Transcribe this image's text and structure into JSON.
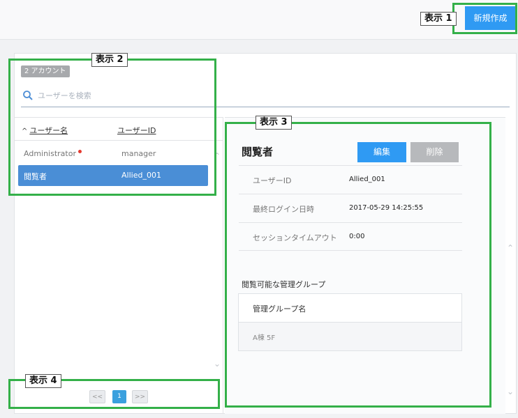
{
  "header": {
    "new_button": "新規作成"
  },
  "search": {
    "account_count": "2 アカウント",
    "placeholder": "ユーザーを検索"
  },
  "list": {
    "sort_arrow": "^",
    "col_name": "ユーザー名",
    "col_id": "ユーザーID",
    "rows": [
      {
        "name": "Administrator",
        "id": "manager",
        "status_dot": true
      },
      {
        "name": "閲覧者",
        "id": "Allied_001",
        "selected": true
      }
    ]
  },
  "pagination": {
    "prev": "<<",
    "current": "1",
    "next": ">>"
  },
  "detail": {
    "title": "閲覧者",
    "edit_button": "編集",
    "delete_button": "削除",
    "fields": [
      {
        "label": "ユーザーID",
        "value": "Allied_001"
      },
      {
        "label": "最終ログイン日時",
        "value": "2017-05-29 14:25:55"
      },
      {
        "label": "セッションタイムアウト",
        "value": "0:00"
      }
    ],
    "groups_label": "閲覧可能な管理グループ",
    "groups_header": "管理グループ名",
    "groups": [
      "A棟 5F"
    ]
  },
  "annotations": [
    "表示 1",
    "表示 2",
    "表示 3",
    "表示 4"
  ],
  "colors": {
    "primary": "#2f9af3",
    "selected_row": "#4a8ed6",
    "highlight": "#34b049",
    "status_dot": "#e53a2f"
  }
}
